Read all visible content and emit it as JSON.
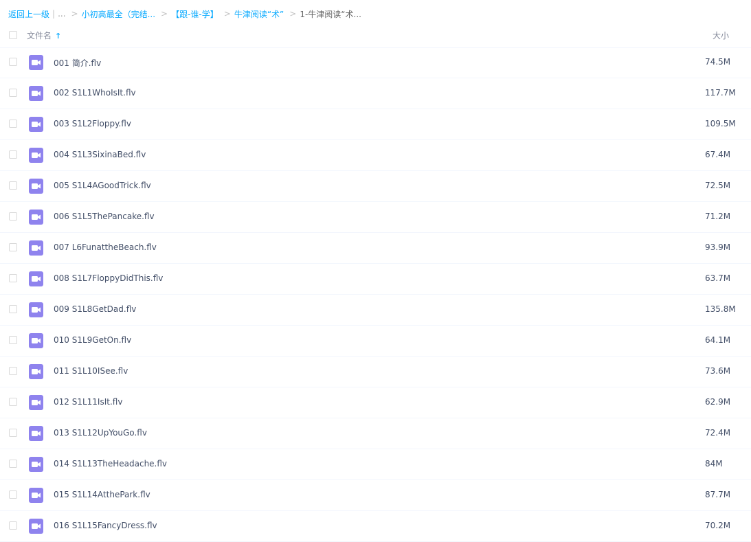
{
  "breadcrumb": {
    "back": "返回上一级",
    "separator": "|",
    "ellipsis": "...",
    "items": [
      "小初高最全（完结...",
      "【跟-谁-学】",
      "牛津阅读“术”"
    ],
    "current": "1-牛津阅读“术..."
  },
  "header": {
    "name_label": "文件名",
    "sort_arrow": "↑",
    "size_label": "大小"
  },
  "file_icon": "video-file-icon",
  "icon_color": "#8f83ee",
  "accent_color": "#09aaff",
  "files": [
    {
      "name": "001 简介.flv",
      "size": "74.5M"
    },
    {
      "name": "002 S1L1WhoIsIt.flv",
      "size": "117.7M"
    },
    {
      "name": "003 S1L2Floppy.flv",
      "size": "109.5M"
    },
    {
      "name": "004 S1L3SixinaBed.flv",
      "size": "67.4M"
    },
    {
      "name": "005 S1L4AGoodTrick.flv",
      "size": "72.5M"
    },
    {
      "name": "006 S1L5ThePancake.flv",
      "size": "71.2M"
    },
    {
      "name": "007 L6FunattheBeach.flv",
      "size": "93.9M"
    },
    {
      "name": "008 S1L7FloppyDidThis.flv",
      "size": "63.7M"
    },
    {
      "name": "009 S1L8GetDad.flv",
      "size": "135.8M"
    },
    {
      "name": "010 S1L9GetOn.flv",
      "size": "64.1M"
    },
    {
      "name": "011 S1L10ISee.flv",
      "size": "73.6M"
    },
    {
      "name": "012 S1L11IsIt.flv",
      "size": "62.9M"
    },
    {
      "name": "013 S1L12UpYouGo.flv",
      "size": "72.4M"
    },
    {
      "name": "014 S1L13TheHeadache.flv",
      "size": "84M"
    },
    {
      "name": "015 S1L14AtthePark.flv",
      "size": "87.7M"
    },
    {
      "name": "016 S1L15FancyDress.flv",
      "size": "70.2M"
    }
  ]
}
